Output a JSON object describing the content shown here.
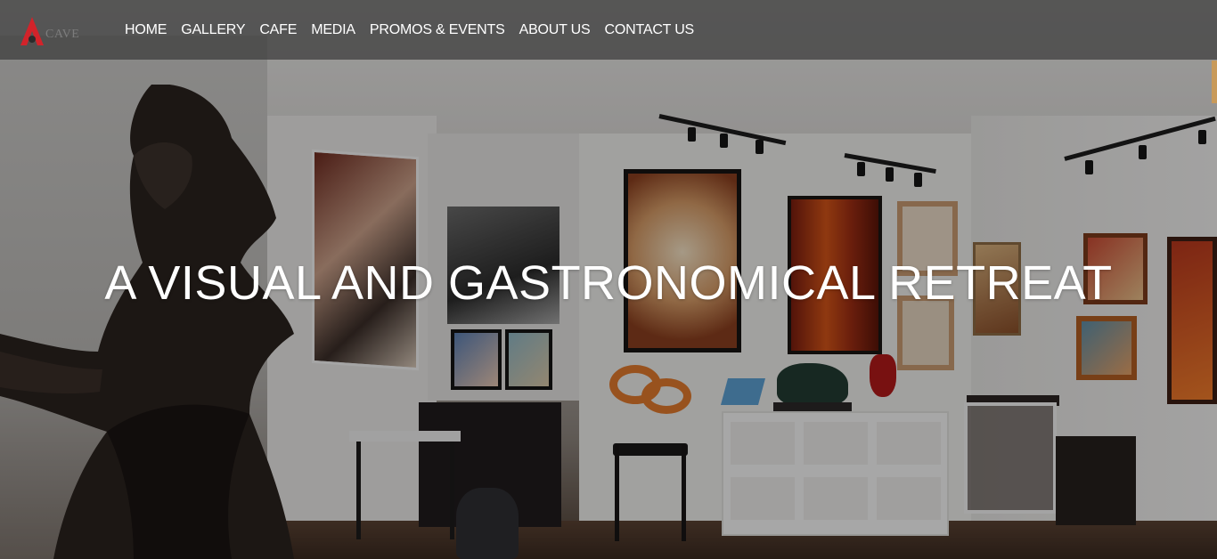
{
  "site": {
    "logo_text": "CAVE"
  },
  "nav": {
    "items": [
      {
        "label": "HOME"
      },
      {
        "label": "GALLERY"
      },
      {
        "label": "CAFE"
      },
      {
        "label": "MEDIA"
      },
      {
        "label": "PROMOS & EVENTS"
      },
      {
        "label": "ABOUT US"
      },
      {
        "label": "CONTACT US"
      }
    ]
  },
  "hero": {
    "title": "A VISUAL AND GASTRONOMICAL RETREAT"
  },
  "colors": {
    "header_bg": "#3a3a3a",
    "logo_accent": "#d2232a",
    "nav_text": "#ffffff",
    "title_text": "#ffffff",
    "scroll_marker": "#c89a5a"
  }
}
